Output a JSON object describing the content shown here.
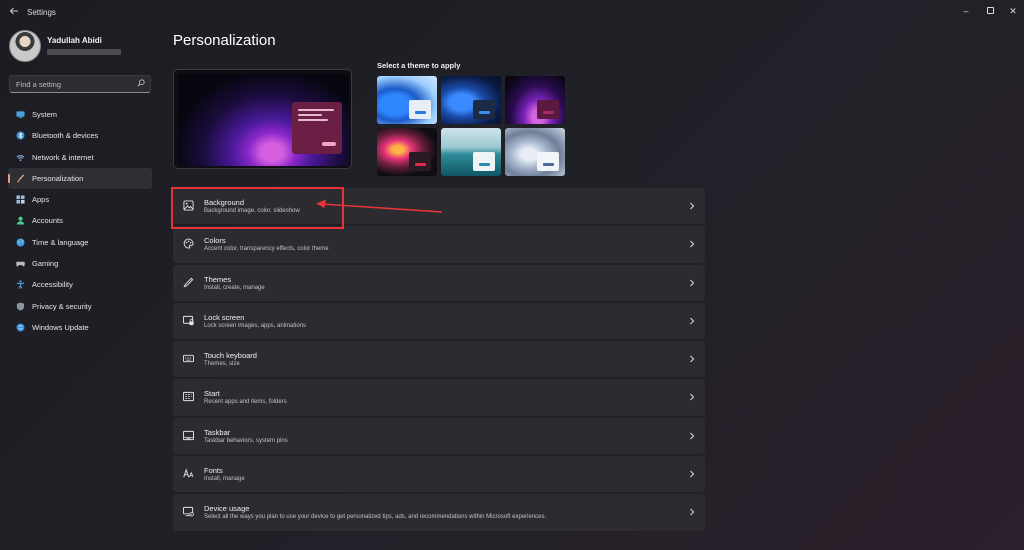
{
  "window": {
    "title": "Settings",
    "back_icon": "back-arrow-icon"
  },
  "profile": {
    "name": "Yadullah Abidi"
  },
  "search": {
    "placeholder": "Find a setting",
    "icon": "search-icon"
  },
  "sidebar": {
    "items": [
      {
        "label": "System",
        "icon": "system-icon",
        "active": false
      },
      {
        "label": "Bluetooth & devices",
        "icon": "bluetooth-icon",
        "active": false
      },
      {
        "label": "Network & internet",
        "icon": "network-icon",
        "active": false
      },
      {
        "label": "Personalization",
        "icon": "brush-icon",
        "active": true
      },
      {
        "label": "Apps",
        "icon": "apps-icon",
        "active": false
      },
      {
        "label": "Accounts",
        "icon": "accounts-icon",
        "active": false
      },
      {
        "label": "Time & language",
        "icon": "globe-icon",
        "active": false
      },
      {
        "label": "Gaming",
        "icon": "gaming-icon",
        "active": false
      },
      {
        "label": "Accessibility",
        "icon": "accessibility-icon",
        "active": false
      },
      {
        "label": "Privacy & security",
        "icon": "shield-icon",
        "active": false
      },
      {
        "label": "Windows Update",
        "icon": "update-icon",
        "active": false
      }
    ]
  },
  "main": {
    "title": "Personalization",
    "themes_label": "Select a theme to apply",
    "rows": [
      {
        "title": "Background",
        "subtitle": "Background image, color, slideshow",
        "icon": "image-icon"
      },
      {
        "title": "Colors",
        "subtitle": "Accent color, transparency effects, color theme",
        "icon": "palette-icon"
      },
      {
        "title": "Themes",
        "subtitle": "Install, create, manage",
        "icon": "pen-icon"
      },
      {
        "title": "Lock screen",
        "subtitle": "Lock screen images, apps, animations",
        "icon": "lock-screen-icon"
      },
      {
        "title": "Touch keyboard",
        "subtitle": "Themes, size",
        "icon": "keyboard-icon"
      },
      {
        "title": "Start",
        "subtitle": "Recent apps and items, folders",
        "icon": "start-icon"
      },
      {
        "title": "Taskbar",
        "subtitle": "Taskbar behaviors, system pins",
        "icon": "taskbar-icon"
      },
      {
        "title": "Fonts",
        "subtitle": "Install, manage",
        "icon": "fonts-icon"
      },
      {
        "title": "Device usage",
        "subtitle": "Select all the ways you plan to use your device to get personalized tips, ads, and recommendations within Microsoft experiences.",
        "icon": "device-usage-icon"
      }
    ]
  },
  "colors": {
    "accent": "#e7a17a",
    "annotation": "#e5353a"
  }
}
